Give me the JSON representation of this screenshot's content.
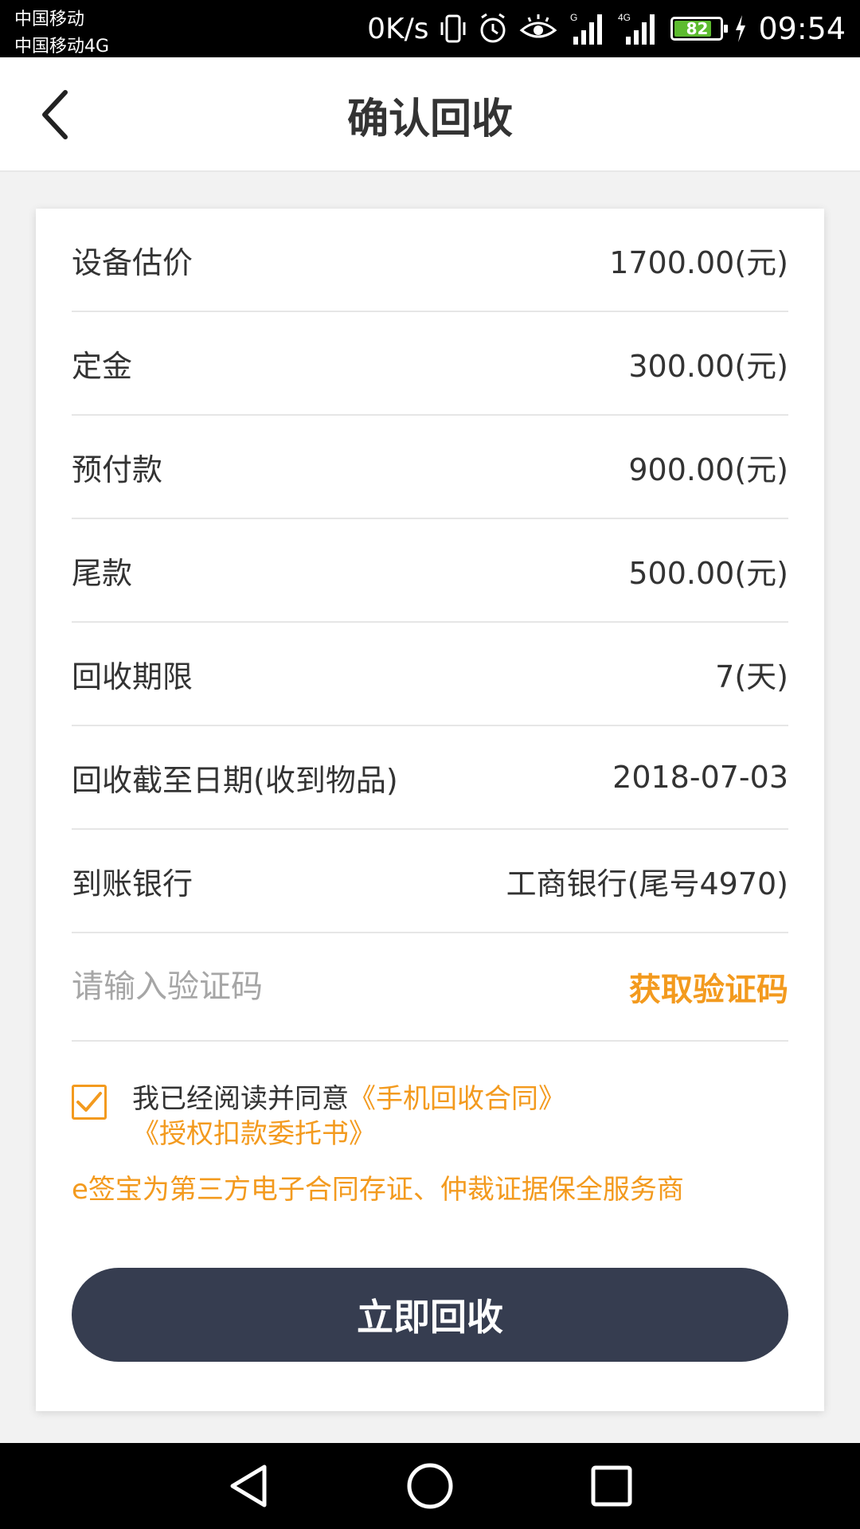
{
  "status_bar": {
    "carrier1": "中国移动",
    "carrier2": "中国移动4G",
    "net_speed": "0K/s",
    "battery_level": "82",
    "battery_fraction": 0.82,
    "time": "09:54"
  },
  "nav": {
    "title": "确认回收"
  },
  "rows": [
    {
      "label": "设备估价",
      "value": "1700.00(元)"
    },
    {
      "label": "定金",
      "value": "300.00(元)"
    },
    {
      "label": "预付款",
      "value": "900.00(元)"
    },
    {
      "label": "尾款",
      "value": "500.00(元)"
    },
    {
      "label": "回收期限",
      "value": "7(天)"
    },
    {
      "label": "回收截至日期(收到物品)",
      "value": "2018-07-03"
    },
    {
      "label": "到账银行",
      "value": "工商银行(尾号4970)"
    }
  ],
  "verification": {
    "placeholder": "请输入验证码",
    "value": "",
    "get_code_label": "获取验证码"
  },
  "agreement": {
    "checked": true,
    "prefix": "我已经阅读并同意",
    "contract1": "《手机回收合同》",
    "contract2": "《授权扣款委托书》",
    "esign_note": "e签宝为第三方电子合同存证、仲裁证据保全服务商"
  },
  "submit_label": "立即回收",
  "colors": {
    "accent": "#f39a1e",
    "button": "#363d50",
    "battery": "#5dbb2f"
  }
}
